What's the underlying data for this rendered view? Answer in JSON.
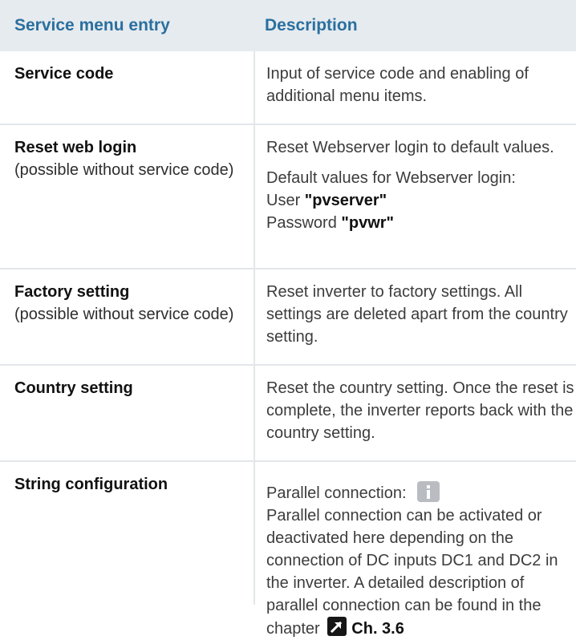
{
  "header": {
    "col1": "Service menu entry",
    "col2": "Description"
  },
  "rows": [
    {
      "title": "Service code",
      "desc1": "Input of service code and enabling of additional menu items."
    },
    {
      "title": "Reset web login",
      "sub": "(possible without service code)",
      "desc1": "Reset Webserver login to default values.",
      "desc2_line1": "Default values for Webserver login:",
      "user_label": "User",
      "user_value": "\"pvserver\"",
      "password_label": "Password",
      "password_value": "\"pvwr\""
    },
    {
      "title": "Factory setting",
      "sub": "(possible without service code)",
      "desc1": "Reset inverter to factory settings. All settings are deleted apart from the country setting."
    },
    {
      "title": "Country setting",
      "desc1": "Reset the country setting. Once the reset is complete, the inverter reports back with the country setting."
    },
    {
      "title": "String configuration",
      "desc_label": "Parallel connection:",
      "desc1": "Parallel connection can be activated or deactivated here depending on the connection of DC inputs DC1 and DC2 in the inverter. A detailed description of parallel connection can be found in the chapter",
      "chapter_ref": "Ch. 3.6"
    }
  ],
  "icons": {
    "info": "info-icon",
    "reference": "arrow-reference-icon"
  },
  "colors": {
    "header_bg": "#e6ebef",
    "header_text": "#2a6f9e",
    "divider": "#e3e6e9"
  }
}
